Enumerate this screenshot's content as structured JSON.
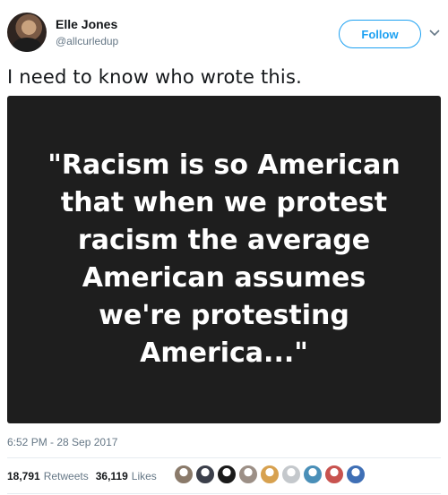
{
  "user": {
    "name": "Elle Jones",
    "handle": "@allcurledup",
    "follow_label": "Follow"
  },
  "tweet": {
    "text": "I need to know who wrote this.",
    "image_lines": [
      "\"Racism is so American",
      "that when we protest",
      "racism the average",
      "American assumes",
      "we're protesting",
      "America...\""
    ],
    "timestamp": "6:52 PM - 28 Sep 2017"
  },
  "stats": {
    "retweets_count": "18,791",
    "retweets_label": "Retweets",
    "likes_count": "36,119",
    "likes_label": "Likes"
  },
  "liker_avatars": [
    {
      "color": "#8a7a6a",
      "icon": "avatar-1"
    },
    {
      "color": "#3b3f4a",
      "icon": "avatar-2"
    },
    {
      "color": "#1a1a1a",
      "icon": "avatar-3"
    },
    {
      "color": "#9c8f86",
      "icon": "avatar-4"
    },
    {
      "color": "#d7a14f",
      "icon": "avatar-5"
    },
    {
      "color": "#c4c8cc",
      "icon": "avatar-6"
    },
    {
      "color": "#4a8fb8",
      "icon": "avatar-7"
    },
    {
      "color": "#c8534f",
      "icon": "avatar-8"
    },
    {
      "color": "#3f6fb5",
      "icon": "avatar-9"
    }
  ],
  "colors": {
    "accent": "#1da1f2",
    "muted": "#657786",
    "image_bg": "#1e1e1e"
  }
}
